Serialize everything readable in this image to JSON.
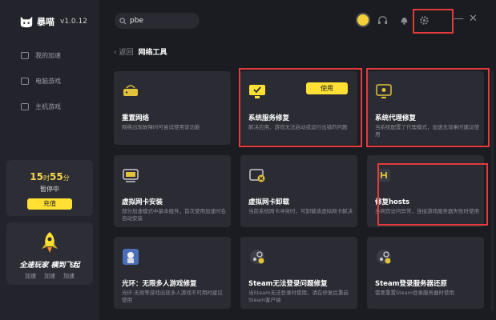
{
  "app": {
    "name": "暴喵",
    "version": "v1.0.12"
  },
  "sidebar": {
    "nav": [
      {
        "label": "我的加速",
        "icon": "accelerate-icon"
      },
      {
        "label": "电脑游戏",
        "icon": "monitor-icon"
      },
      {
        "label": "主机游戏",
        "icon": "gamepad-icon"
      }
    ],
    "time_card": {
      "hours": "15",
      "hours_unit": "时",
      "minutes": "55",
      "minutes_unit": "分",
      "status": "暂停中",
      "recharge_label": "充值"
    },
    "promo": {
      "title": "全速玩家  横到飞起",
      "tags": [
        "加速",
        "加速",
        "加速"
      ]
    }
  },
  "search": {
    "value": "pbe",
    "placeholder": ""
  },
  "breadcrumb": {
    "back_label": "返回",
    "title": "网络工具"
  },
  "window": {
    "minimize": "—",
    "close": "✕"
  },
  "cards": [
    {
      "title": "重置网络",
      "desc": "网络出现故障时可尝试使用该功能",
      "icon": "router-icon"
    },
    {
      "title": "系统服务修复",
      "desc": "解决应用、游戏无法启动或运行出错的问题",
      "icon": "monitor-fix-icon",
      "button": "使用"
    },
    {
      "title": "系统代理修复",
      "desc": "当系统配置了代理模式，加速无效果时建议使用",
      "icon": "proxy-icon"
    },
    {
      "title": "虚拟网卡安装",
      "desc": "部分加速模式中基本组件，首次使用加速时会自动安装",
      "icon": "nic-install-icon"
    },
    {
      "title": "虚拟网卡卸载",
      "desc": "当前系统网卡冲突时，可卸载该虚拟网卡解决",
      "icon": "nic-uninstall-icon"
    },
    {
      "title": "修复hosts",
      "desc": "多网页访问异常，连接游戏服务器失败时使用",
      "icon": "hosts-icon"
    },
    {
      "title": "光环：无限多人游戏修复",
      "desc": "光环:无限等游戏出现多人游戏不可用时建议使用",
      "icon": "halo-icon"
    },
    {
      "title": "Steam无法登录问题修复",
      "desc": "当Steam无法登录时使用，请在修复后重启Steam客户端",
      "icon": "steam-icon"
    },
    {
      "title": "Steam登录服务器还原",
      "desc": "需要重置Steam登录服务器时使用",
      "icon": "steam-restore-icon"
    }
  ],
  "colors": {
    "accent": "#ffe033",
    "highlight": "#e23b3b",
    "background": "#1b1c22",
    "card": "#2a2b33"
  }
}
